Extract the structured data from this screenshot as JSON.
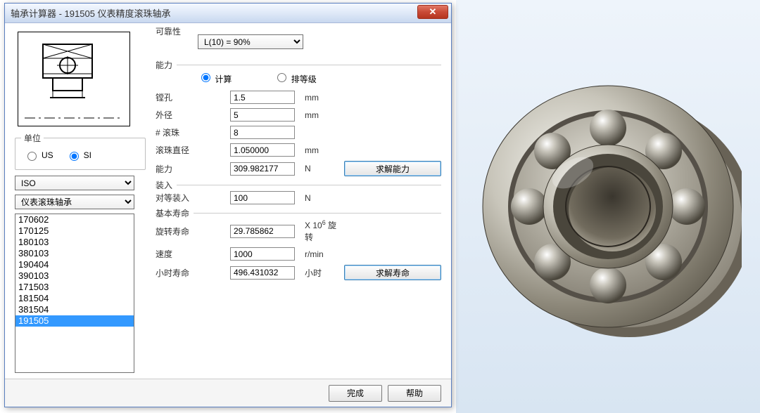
{
  "window": {
    "title": "轴承计算器 - 191505 仪表精度滚珠轴承",
    "close": "✕"
  },
  "leftPanel": {
    "unitsLegend": "单位",
    "unitUS": "US",
    "unitSI": "SI",
    "standardCombo": "ISO",
    "typeCombo": "仪表滚珠轴承",
    "listItems": [
      "170602",
      "170125",
      "180103",
      "380103",
      "190404",
      "390103",
      "171503",
      "181504",
      "381504",
      "191505"
    ],
    "selectedIndex": 9
  },
  "reliability": {
    "label": "可靠性",
    "comboValue": "L(10) = 90%"
  },
  "capacity": {
    "label": "能力",
    "radioCalc": "计算",
    "radioRank": "排等级",
    "fields": {
      "bore": {
        "label": "镗孔",
        "value": "1.5",
        "unit": "mm"
      },
      "od": {
        "label": "外径",
        "value": "5",
        "unit": "mm"
      },
      "balls": {
        "label": "# 滚珠",
        "value": "8",
        "unit": ""
      },
      "balldia": {
        "label": "滚珠直径",
        "value": "1.050000",
        "unit": "mm"
      },
      "cap": {
        "label": "能力",
        "value": "309.982177",
        "unit": "N"
      }
    },
    "solveCapacityBtn": "求解能力"
  },
  "loading": {
    "label": "装入",
    "fields": {
      "equiv": {
        "label": "对等装入",
        "value": "100",
        "unit": "N"
      }
    }
  },
  "life": {
    "label": "基本寿命",
    "fields": {
      "rev": {
        "label": "旋转寿命",
        "value": "29.785862",
        "unit_pre": "X 10",
        "unit_exp": "6",
        "unit_post": "旋转"
      },
      "speed": {
        "label": "速度",
        "value": "1000",
        "unit": "r/min"
      },
      "hours": {
        "label": "小时寿命",
        "value": "496.431032",
        "unit": "小时"
      }
    },
    "solveLifeBtn": "求解寿命"
  },
  "buttons": {
    "finish": "完成",
    "help": "帮助"
  }
}
